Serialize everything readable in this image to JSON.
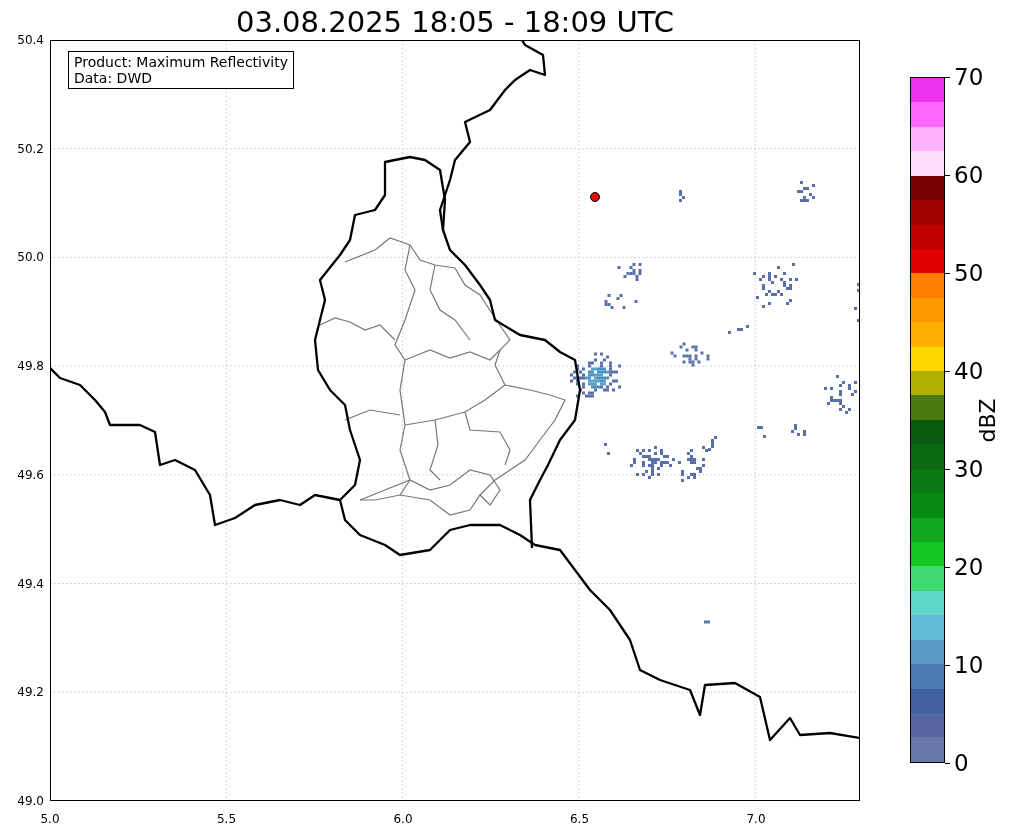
{
  "title": "03.08.2025 18:05 - 18:09 UTC",
  "map": {
    "legend": [
      "Product: Maximum Reflectivity",
      "Data: DWD"
    ],
    "xticks": [
      "5.0",
      "5.5",
      "6.0",
      "6.5",
      "7.0"
    ],
    "yticks": [
      "50.4",
      "50.2",
      "50.0",
      "49.8",
      "49.6",
      "49.4",
      "49.2",
      "49.0"
    ]
  },
  "colorbar": {
    "label": "dBZ",
    "ticks": [
      "70",
      "60",
      "50",
      "40",
      "30",
      "20",
      "10",
      "0"
    ],
    "bands": [
      {
        "color": "#ee33ee"
      },
      {
        "color": "#ff66ff"
      },
      {
        "color": "#ffb0ff"
      },
      {
        "color": "#ffddff"
      },
      {
        "color": "#7a0000"
      },
      {
        "color": "#a00000"
      },
      {
        "color": "#c00000"
      },
      {
        "color": "#e00000"
      },
      {
        "color": "#ff7f00"
      },
      {
        "color": "#ff9900"
      },
      {
        "color": "#ffb000"
      },
      {
        "color": "#ffd700"
      },
      {
        "color": "#b0b000"
      },
      {
        "color": "#4a7a10"
      },
      {
        "color": "#0a5a10"
      },
      {
        "color": "#0a6a12"
      },
      {
        "color": "#0a7a14"
      },
      {
        "color": "#0a8a12"
      },
      {
        "color": "#10a820"
      },
      {
        "color": "#10c820"
      },
      {
        "color": "#40d870"
      },
      {
        "color": "#60d8c8"
      },
      {
        "color": "#60bcd8"
      },
      {
        "color": "#5a9ac4"
      },
      {
        "color": "#4a7ab0"
      },
      {
        "color": "#4060a0"
      },
      {
        "color": "#5566a0"
      },
      {
        "color": "#6677aa"
      }
    ]
  }
}
